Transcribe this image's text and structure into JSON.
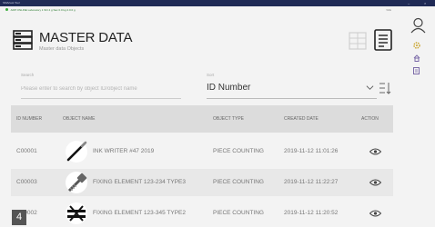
{
  "window": {
    "title": "SMArtest Tool",
    "min": "–",
    "close": "×"
  },
  "status": {
    "text": "ARP ONLINE  Laboratory 1  Shl 4 g  Sav 0.0 kg  2.0.0 g",
    "right": "WIE"
  },
  "header": {
    "title": "MASTER DATA",
    "subtitle": "Master data Objects"
  },
  "search": {
    "label": "Search",
    "placeholder": "Please enter to search by object ID/object name"
  },
  "sort": {
    "label": "Sort",
    "value": "ID Number"
  },
  "table": {
    "columns": [
      "ID NUMBER",
      "OBJECT NAME",
      "OBJECT TYPE",
      "CREATED DATE",
      "ACTION"
    ],
    "rows": [
      {
        "id": "C00001",
        "name": "INK WRITER #47 2019",
        "type": "PIECE COUNTING",
        "date": "2019-11-12 11:01:26",
        "thumb": "pen"
      },
      {
        "id": "C00003",
        "name": "FIXING ELEMENT 123-234 TYPE3",
        "type": "PIECE COUNTING",
        "date": "2019-11-12 11:22:27",
        "thumb": "screw"
      },
      {
        "id": "C00002",
        "name": "FIXING ELEMENT 123-345 TYPE2",
        "type": "PIECE COUNTING",
        "date": "2019-11-12 11:20:52",
        "thumb": "clamp"
      }
    ]
  },
  "page_badge": "4",
  "colors": {
    "accent": "#1f2a55",
    "status_green": "#3cae3c",
    "header_row": "#dcdcdc",
    "alt_row": "#e8e8e8"
  },
  "icons": [
    "user-icon",
    "settings-icon",
    "home-icon",
    "document-icon"
  ]
}
